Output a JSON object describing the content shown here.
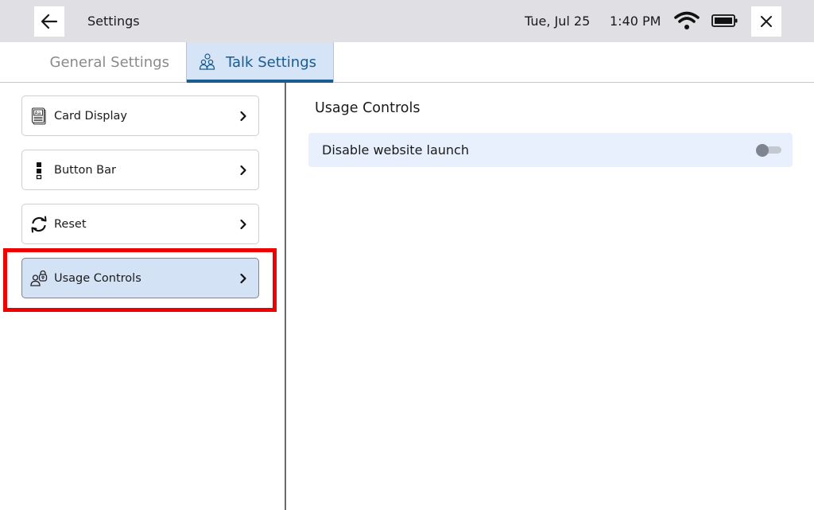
{
  "topbar": {
    "title": "Settings",
    "date": "Tue, Jul 25",
    "time": "1:40 PM",
    "icons": {
      "back": "arrow-left-icon",
      "wifi": "wifi-icon",
      "battery": "battery-icon",
      "close": "close-icon"
    }
  },
  "tabs": [
    {
      "label": "General Settings",
      "active": false
    },
    {
      "label": "Talk Settings",
      "active": true,
      "icon": "talk-people-icon"
    }
  ],
  "sidebar": {
    "items": [
      {
        "label": "Card Display",
        "icon": "card-display-icon",
        "active": false
      },
      {
        "label": "Button Bar",
        "icon": "button-bar-icon",
        "active": false
      },
      {
        "label": "Reset",
        "icon": "reset-icon",
        "active": false
      },
      {
        "label": "Usage Controls",
        "icon": "usage-controls-icon",
        "active": true
      }
    ]
  },
  "main": {
    "title": "Usage Controls",
    "settings": [
      {
        "label": "Disable website launch",
        "enabled": false
      }
    ]
  },
  "colors": {
    "topbar_bg": "#dfdfe4",
    "accent": "#1a5c8f",
    "active_tab_bg": "#d5e4f6",
    "active_item_bg": "#d3e2f5",
    "setting_row_bg": "#e7f0fc",
    "highlight": "#ee0000"
  }
}
